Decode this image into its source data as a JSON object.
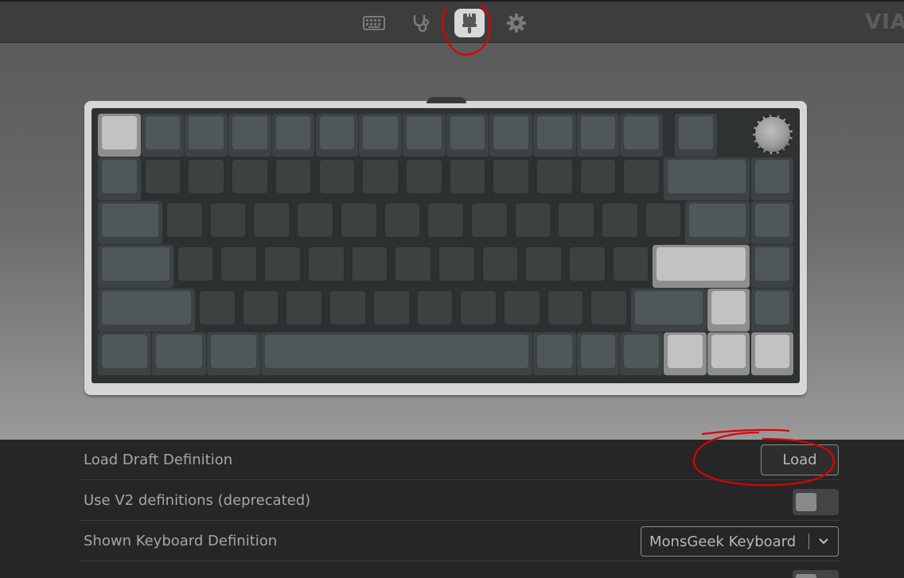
{
  "header": {
    "brand": "VIA",
    "nav": [
      {
        "name": "configure",
        "icon": "keyboard-icon",
        "active": false
      },
      {
        "name": "test",
        "icon": "stethoscope-icon",
        "active": false
      },
      {
        "name": "design",
        "icon": "paintbrush-icon",
        "active": true
      },
      {
        "name": "settings",
        "icon": "gear-icon",
        "active": false
      }
    ]
  },
  "keyboard": {
    "layout": "75%",
    "has_rotary_knob": true,
    "accent_color": "#c2c2c2",
    "alpha_color": "#3c4141",
    "modifier_color": "#50575a"
  },
  "settings": {
    "load_draft": {
      "label": "Load Draft Definition",
      "button": "Load"
    },
    "use_v2": {
      "label": "Use V2 definitions (deprecated)",
      "enabled": false
    },
    "shown_definition": {
      "label": "Shown Keyboard Definition",
      "value": "MonsGeek Keyboard"
    },
    "partial_row": {
      "label": "",
      "enabled": false
    }
  },
  "annotations": {
    "color": "#e00000"
  }
}
